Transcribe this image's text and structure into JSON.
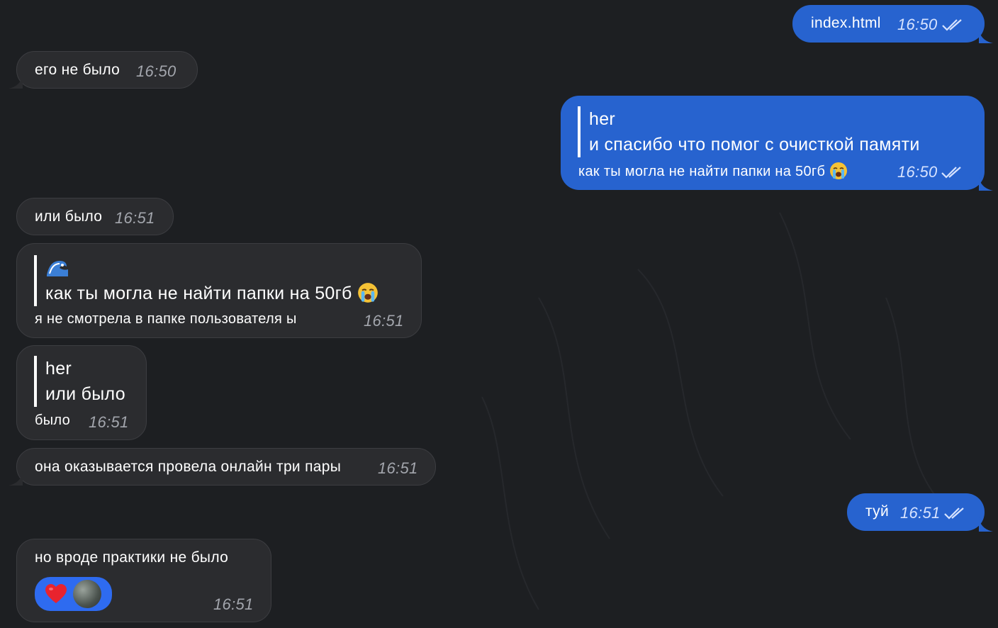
{
  "chat": {
    "messages": {
      "m1": {
        "text": "index.html",
        "time": "16:50"
      },
      "m2": {
        "text": "его не было",
        "time": "16:50"
      },
      "m3": {
        "reply_author": "her",
        "reply_text": "и спасибо что помог с очисткой памяти",
        "text": "как ты могла не найти папки на 50гб",
        "emoji": "loudly-crying-face",
        "time": "16:50"
      },
      "m4": {
        "text": "или было",
        "time": "16:51"
      },
      "m5": {
        "reply_emoji": "wave",
        "reply_text": "как ты могла не найти папки на 50гб",
        "reply_text_emoji": "loudly-crying-face",
        "text": "я не смотрела в папке пользователя ы",
        "time": "16:51"
      },
      "m6": {
        "reply_author": "her",
        "reply_text": "или было",
        "text": "было",
        "time": "16:51"
      },
      "m7": {
        "text": "она оказывается провела онлайн три пары",
        "time": "16:51"
      },
      "m8": {
        "text": "туй",
        "time": "16:51"
      },
      "m9": {
        "text": "но вроде практики не было",
        "time": "16:51",
        "reaction": {
          "emoji": "red-heart"
        }
      }
    }
  },
  "colors": {
    "background": "#1d1f22",
    "incoming_bubble": "#2b2c2f",
    "outgoing_bubble": "#2763cf",
    "reaction_pill": "#2e6bf0",
    "timestamp": "#a3a6ad"
  }
}
